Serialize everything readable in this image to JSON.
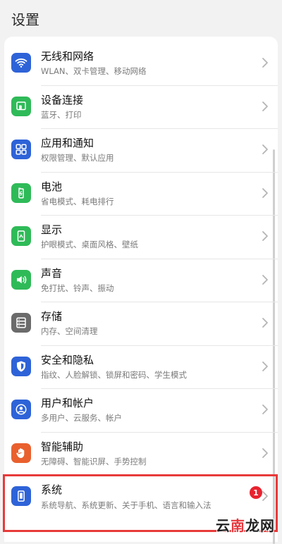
{
  "header": {
    "title": "设置"
  },
  "items": [
    {
      "id": "wlan",
      "title": "无线和网络",
      "subtitle": "WLAN、双卡管理、移动网络",
      "icon": "wifi-icon",
      "color": "#2e63d8"
    },
    {
      "id": "device",
      "title": "设备连接",
      "subtitle": "蓝牙、打印",
      "icon": "device-connect-icon",
      "color": "#2fba58"
    },
    {
      "id": "apps",
      "title": "应用和通知",
      "subtitle": "权限管理、默认应用",
      "icon": "apps-grid-icon",
      "color": "#2e63d8"
    },
    {
      "id": "battery",
      "title": "电池",
      "subtitle": "省电模式、耗电排行",
      "icon": "battery-icon",
      "color": "#2fba58"
    },
    {
      "id": "display",
      "title": "显示",
      "subtitle": "护眼模式、桌面风格、壁纸",
      "icon": "display-icon",
      "color": "#2fba58"
    },
    {
      "id": "sound",
      "title": "声音",
      "subtitle": "免打扰、铃声、振动",
      "icon": "speaker-icon",
      "color": "#2fba58"
    },
    {
      "id": "storage",
      "title": "存储",
      "subtitle": "内存、空间清理",
      "icon": "storage-icon",
      "color": "#6b6b6b"
    },
    {
      "id": "security",
      "title": "安全和隐私",
      "subtitle": "指纹、人脸解锁、锁屏和密码、学生模式",
      "icon": "shield-icon",
      "color": "#2e63d8"
    },
    {
      "id": "accounts",
      "title": "用户和帐户",
      "subtitle": "多用户、云服务、帐户",
      "icon": "user-icon",
      "color": "#2e63d8"
    },
    {
      "id": "accessibility",
      "title": "智能辅助",
      "subtitle": "无障碍、智能识屏、手势控制",
      "icon": "hand-icon",
      "color": "#e9602e"
    },
    {
      "id": "system",
      "title": "系统",
      "subtitle": "系统导航、系统更新、关于手机、语言和输入法",
      "icon": "phone-icon",
      "color": "#2e63d8",
      "badge": "1"
    }
  ],
  "watermark": {
    "part1": "云",
    "part2": "南",
    "part3": "龙网"
  },
  "colors": {
    "highlight": "#e83a3a",
    "badge": "#e8232f"
  }
}
